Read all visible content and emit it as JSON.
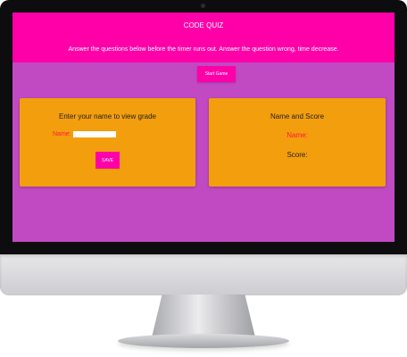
{
  "header": {
    "title": "CODE QUIZ",
    "instructions": "Answer the questions below before the timer runs out. Answer the question wrong, time decrease."
  },
  "start_button": {
    "label": "Start Game"
  },
  "name_card": {
    "heading": "Enter your name to view grade",
    "name_label": "Name:",
    "name_value": "",
    "save_label": "SAVE"
  },
  "score_card": {
    "heading": "Name and Score",
    "name_label": "Name:",
    "score_label": "Score:"
  },
  "colors": {
    "header_bg": "#ff00a8",
    "page_bg": "#c14ac3",
    "card_bg": "#f39e0c",
    "accent_text": "#ff1a40"
  }
}
